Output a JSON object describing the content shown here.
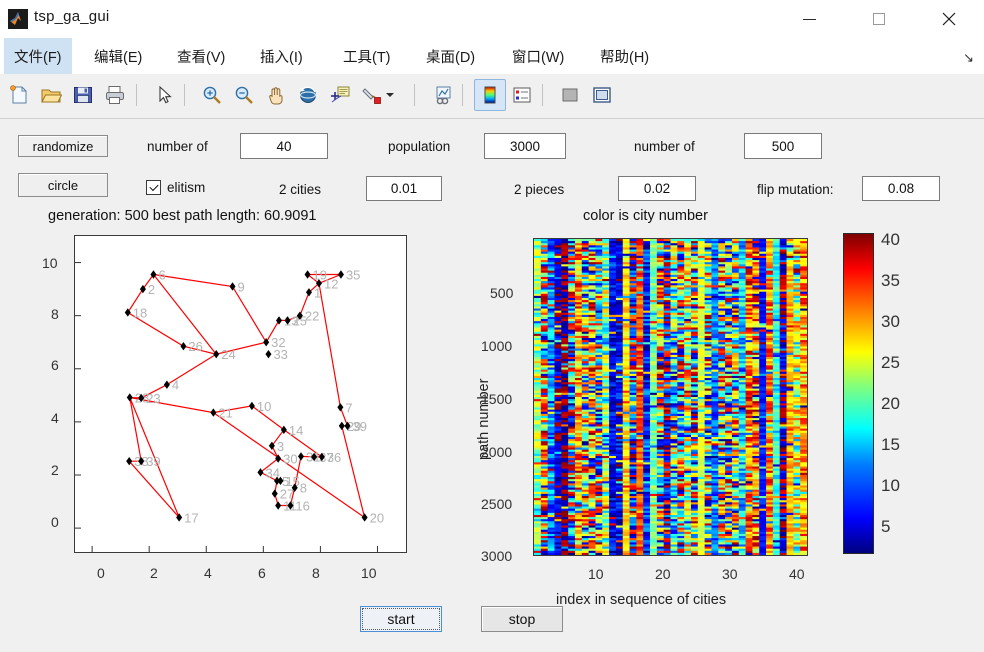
{
  "window": {
    "title": "tsp_ga_gui",
    "icon": "matlab-logo-icon",
    "minimize": "minimize-icon",
    "maximize": "maximize-icon",
    "close": "close-icon"
  },
  "menu": {
    "items": [
      {
        "label": "文件(F)",
        "selected": true
      },
      {
        "label": "编辑(E)",
        "selected": false
      },
      {
        "label": "查看(V)",
        "selected": false
      },
      {
        "label": "插入(I)",
        "selected": false
      },
      {
        "label": "工具(T)",
        "selected": false
      },
      {
        "label": "桌面(D)",
        "selected": false
      },
      {
        "label": "窗口(W)",
        "selected": false
      },
      {
        "label": "帮助(H)",
        "selected": false
      }
    ],
    "overflow_arrow": "↘"
  },
  "toolbar": {
    "items": [
      {
        "name": "new-figure-icon"
      },
      {
        "name": "open-file-icon"
      },
      {
        "name": "save-figure-icon"
      },
      {
        "name": "print-figure-icon"
      },
      {
        "name": "pointer-icon"
      },
      {
        "name": "zoom-in-icon"
      },
      {
        "name": "zoom-out-icon"
      },
      {
        "name": "pan-icon"
      },
      {
        "name": "rotate-3d-icon"
      },
      {
        "name": "data-cursor-icon"
      },
      {
        "name": "brush-data-icon"
      },
      {
        "name": "brush-dropdown-icon"
      },
      {
        "name": "link-plot-icon"
      },
      {
        "name": "insert-colorbar-icon"
      },
      {
        "name": "insert-legend-icon"
      },
      {
        "name": "hide-plot-tools-icon"
      },
      {
        "name": "show-plot-tools-icon"
      }
    ]
  },
  "controls": {
    "randomize_label": "randomize",
    "circle_label": "circle",
    "number_of_cities_label": "number of",
    "number_of_cities_value": "40",
    "population_label": "population",
    "population_value": "3000",
    "number_of_generations_label": "number of",
    "number_of_generations_value": "500",
    "elitism_label": "elitism",
    "elitism_checked": true,
    "swap_two_cities_label": "2 cities",
    "swap_two_cities_value": "0.01",
    "swap_two_pieces_label": "2 pieces",
    "swap_two_pieces_value": "0.02",
    "flip_mutation_label": "flip mutation:",
    "flip_mutation_value": "0.08"
  },
  "status": {
    "left": "generation: 500  best path length: 60.9091",
    "right": "color is city number"
  },
  "buttons": {
    "start": "start",
    "stop": "stop"
  },
  "chart_data": [
    {
      "type": "scatter",
      "name": "tsp-tour-plot",
      "title": "generation: 500  best path length: 60.9091",
      "xlabel": "",
      "ylabel": "",
      "xlim": [
        -0.6,
        11.0
      ],
      "ylim": [
        -0.9,
        11.0
      ],
      "xticks": [
        0,
        2,
        4,
        6,
        8,
        10
      ],
      "yticks": [
        0,
        2,
        4,
        6,
        8,
        10
      ],
      "grid": false,
      "marker": "diamond",
      "marker_color": "#000000",
      "path_color": "#ff0000",
      "label_color": "#b3b3b3",
      "cities": [
        {
          "id": "6",
          "x": 2.15,
          "y": 9.55
        },
        {
          "id": "2",
          "x": 1.78,
          "y": 9.0
        },
        {
          "id": "18",
          "x": 1.25,
          "y": 8.12
        },
        {
          "id": "9",
          "x": 4.92,
          "y": 9.1
        },
        {
          "id": "32",
          "x": 6.1,
          "y": 7.0
        },
        {
          "id": "26",
          "x": 3.2,
          "y": 6.85
        },
        {
          "id": "24",
          "x": 4.35,
          "y": 6.55
        },
        {
          "id": "4",
          "x": 2.62,
          "y": 5.4
        },
        {
          "id": "23",
          "x": 1.72,
          "y": 4.9
        },
        {
          "id": "28",
          "x": 1.32,
          "y": 4.92
        },
        {
          "id": "19",
          "x": 7.55,
          "y": 9.55
        },
        {
          "id": "35",
          "x": 8.72,
          "y": 9.55
        },
        {
          "id": "12",
          "x": 7.95,
          "y": 9.22
        },
        {
          "id": "1",
          "x": 7.6,
          "y": 8.88
        },
        {
          "id": "22",
          "x": 7.28,
          "y": 8.0
        },
        {
          "id": "25",
          "x": 6.85,
          "y": 7.82
        },
        {
          "id": "13",
          "x": 6.55,
          "y": 7.82
        },
        {
          "id": "7",
          "x": 8.7,
          "y": 4.55
        },
        {
          "id": "29",
          "x": 8.75,
          "y": 3.85
        },
        {
          "id": "39",
          "x": 8.95,
          "y": 3.85
        },
        {
          "id": "10",
          "x": 5.6,
          "y": 4.6
        },
        {
          "id": "21",
          "x": 4.25,
          "y": 4.35
        },
        {
          "id": "38",
          "x": 1.3,
          "y": 2.52
        },
        {
          "id": "39b",
          "x": 1.72,
          "y": 2.52
        },
        {
          "id": "17",
          "x": 3.05,
          "y": 0.4
        },
        {
          "id": "14",
          "x": 6.72,
          "y": 3.7
        },
        {
          "id": "3",
          "x": 6.3,
          "y": 3.1
        },
        {
          "id": "31",
          "x": 7.32,
          "y": 2.7
        },
        {
          "id": "37",
          "x": 7.78,
          "y": 2.68
        },
        {
          "id": "36",
          "x": 8.05,
          "y": 2.68
        },
        {
          "id": "30",
          "x": 6.52,
          "y": 2.62
        },
        {
          "id": "34",
          "x": 5.9,
          "y": 2.1
        },
        {
          "id": "5",
          "x": 6.48,
          "y": 1.78
        },
        {
          "id": "15",
          "x": 6.6,
          "y": 1.78
        },
        {
          "id": "27",
          "x": 6.4,
          "y": 1.3
        },
        {
          "id": "11",
          "x": 6.52,
          "y": 0.85
        },
        {
          "id": "16",
          "x": 6.95,
          "y": 0.85
        },
        {
          "id": "8",
          "x": 7.1,
          "y": 1.52
        },
        {
          "id": "20",
          "x": 9.55,
          "y": 0.4
        },
        {
          "id": "33",
          "x": 6.18,
          "y": 6.55
        }
      ],
      "tour_order": [
        "6",
        "2",
        "18",
        "26",
        "24",
        "32",
        "9",
        "6",
        "24",
        "4",
        "23",
        "28",
        "17",
        "38",
        "39b",
        "28",
        "21",
        "10",
        "14",
        "3",
        "30",
        "34",
        "5",
        "27",
        "11",
        "16",
        "8",
        "31",
        "37",
        "36",
        "14",
        "10",
        "21",
        "20",
        "29",
        "39",
        "7",
        "12",
        "19",
        "35",
        "12",
        "1",
        "22",
        "25",
        "13",
        "32"
      ]
    },
    {
      "type": "heatmap",
      "name": "path-population-heatmap",
      "title": "color is city number",
      "xlabel": "index in sequence of cities",
      "ylabel": "path number",
      "xticks": [
        10,
        20,
        30,
        40
      ],
      "yticks": [
        500,
        1000,
        1500,
        2000,
        2500,
        3000
      ],
      "xlim": [
        0.5,
        40.5
      ],
      "ylim": [
        1,
        3000
      ],
      "colormap": "jet",
      "colorbar": {
        "min": 1,
        "max": 40,
        "ticks": [
          5,
          10,
          15,
          20,
          25,
          30,
          35,
          40
        ],
        "label": ""
      },
      "description": "3000 x 40 matrix of city indices (1-40) for each path in the population; rows are paths, columns are sequence positions. Strong vertical banding: columns share similar city indices across the population."
    }
  ],
  "colors": {
    "accent": "#cfe2f3",
    "path_red": "#ff0000",
    "panel_bg": "#f0f0f0",
    "axes_bg": "#ffffff",
    "focus_blue": "#4a90d9"
  }
}
